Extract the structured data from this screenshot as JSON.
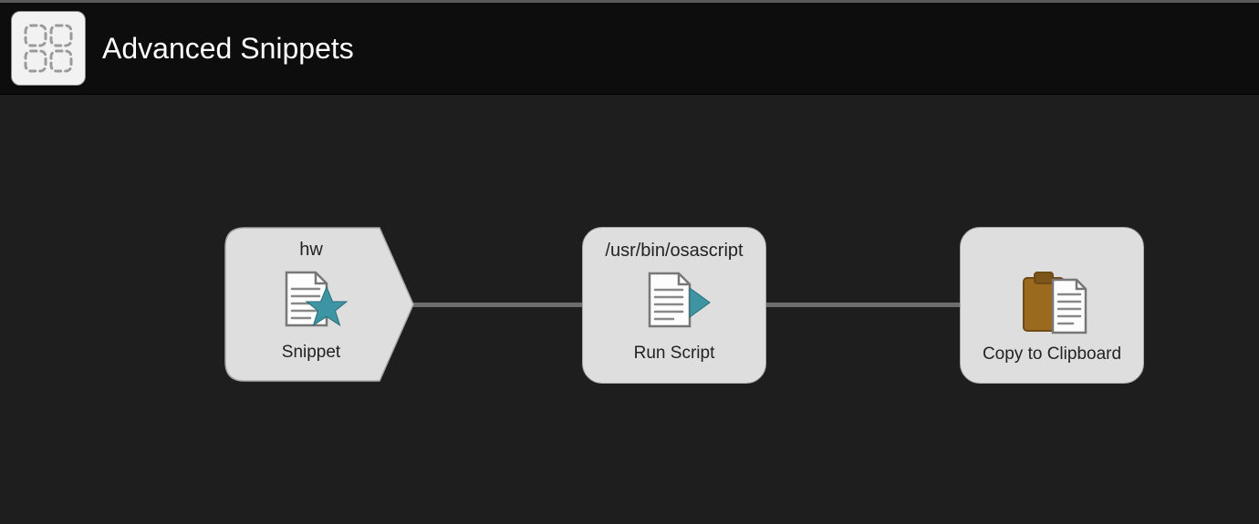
{
  "header": {
    "title": "Advanced Snippets"
  },
  "nodes": {
    "snippet": {
      "title": "hw",
      "subtitle": "Snippet"
    },
    "runscript": {
      "title": "/usr/bin/osascript",
      "subtitle": "Run Script"
    },
    "clipboard": {
      "title": "",
      "subtitle": "Copy to Clipboard"
    }
  }
}
